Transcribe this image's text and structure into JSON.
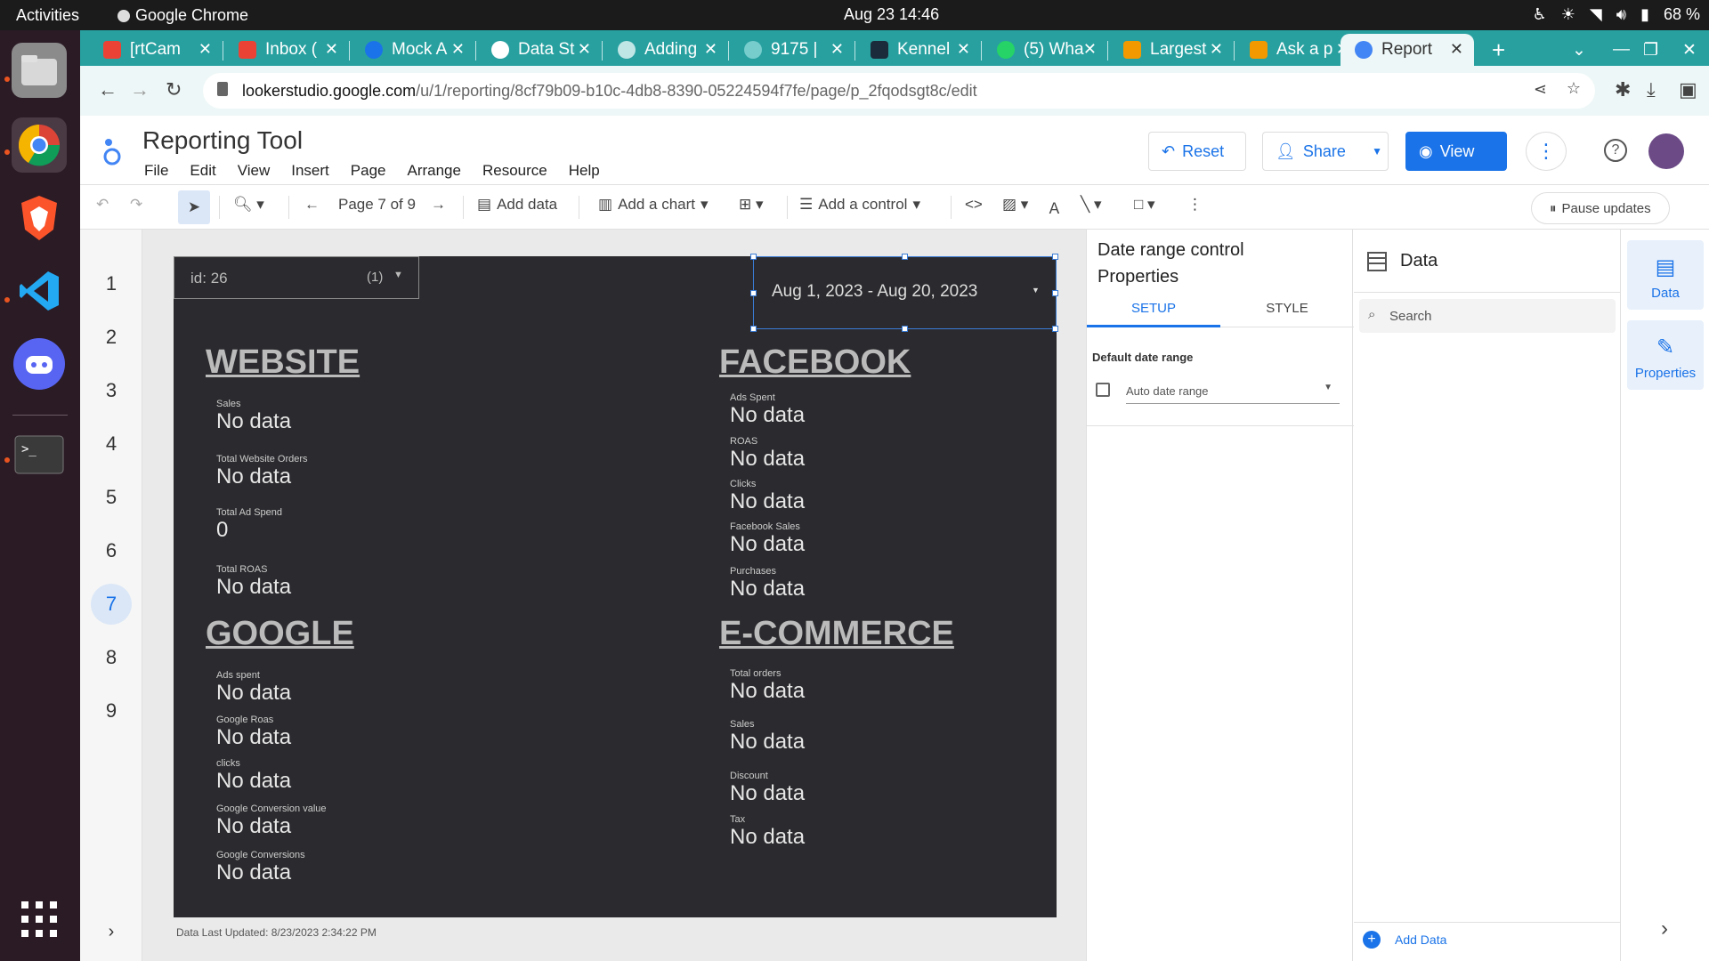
{
  "system": {
    "activities": "Activities",
    "app": "Google Chrome",
    "clock": "Aug 23  14:46",
    "battery": "68 %"
  },
  "tabs": [
    {
      "label": "[rtCam",
      "color": "#ea4335"
    },
    {
      "label": "Inbox (",
      "color": "#ea4335"
    },
    {
      "label": "Mock A",
      "color": "#1a73e8"
    },
    {
      "label": "Data St",
      "color": "#ffffff"
    },
    {
      "label": "Adding",
      "color": "#ffffff"
    },
    {
      "label": "9175 |",
      "color": "#999999"
    },
    {
      "label": "Kennel",
      "color": "#333333"
    },
    {
      "label": "(5) Wha",
      "color": "#25d366"
    },
    {
      "label": "Largest",
      "color": "#f29900"
    },
    {
      "label": "Ask a p",
      "color": "#f29900"
    },
    {
      "label": "Report",
      "color": "#4285f4"
    }
  ],
  "url": {
    "host": "lookerstudio.google.com",
    "path": "/u/1/reporting/8cf79b09-b10c-4db8-8390-05224594f7fe/page/p_2fqodsgt8c/edit"
  },
  "app": {
    "title": "Reporting Tool",
    "menu": [
      "File",
      "Edit",
      "View",
      "Insert",
      "Page",
      "Arrange",
      "Resource",
      "Help"
    ],
    "reset": "Reset",
    "share": "Share",
    "view": "View"
  },
  "toolbar": {
    "page": "Page 7 of 9",
    "add_data": "Add data",
    "add_chart": "Add a chart",
    "add_control": "Add a control",
    "pause": "Pause updates"
  },
  "pages": [
    "1",
    "2",
    "3",
    "4",
    "5",
    "6",
    "7",
    "8",
    "9"
  ],
  "canvas": {
    "id_control": {
      "label": "id",
      "value": "26",
      "count": "(1)"
    },
    "date_range": "Aug 1, 2023 - Aug 20, 2023",
    "website": {
      "title": "WEBSITE",
      "metrics": [
        {
          "label": "Sales",
          "value": "No data"
        },
        {
          "label": "Total Website Orders",
          "value": "No data"
        },
        {
          "label": "Total Ad Spend",
          "value": "0"
        },
        {
          "label": "Total ROAS",
          "value": "No data"
        }
      ]
    },
    "facebook": {
      "title": "FACEBOOK",
      "metrics": [
        {
          "label": "Ads Spent",
          "value": "No data"
        },
        {
          "label": "ROAS",
          "value": "No data"
        },
        {
          "label": "Clicks",
          "value": "No data"
        },
        {
          "label": "Facebook Sales",
          "value": "No data"
        },
        {
          "label": "Purchases",
          "value": "No data"
        }
      ]
    },
    "google": {
      "title": "GOOGLE",
      "metrics": [
        {
          "label": "Ads spent",
          "value": "No data"
        },
        {
          "label": "Google Roas",
          "value": "No data"
        },
        {
          "label": "clicks",
          "value": "No data"
        },
        {
          "label": "Google Conversion value",
          "value": "No data"
        },
        {
          "label": "Google Conversions",
          "value": "No data"
        }
      ]
    },
    "ecommerce": {
      "title": "E-COMMERCE ",
      "metrics": [
        {
          "label": "Total orders",
          "value": "No data"
        },
        {
          "label": "Sales",
          "value": "No data"
        },
        {
          "label": "Discount",
          "value": "No data"
        },
        {
          "label": "Tax",
          "value": "No data"
        }
      ]
    },
    "last_updated": "Data Last Updated: 8/23/2023 2:34:22 PM"
  },
  "properties": {
    "title_line1": "Date range control",
    "title_line2": "Properties",
    "tab_setup": "SETUP",
    "tab_style": "STYLE",
    "default_label": "Default date range",
    "default_value": "Auto date range"
  },
  "data_panel": {
    "title": "Data",
    "search_placeholder": "Search",
    "add_data": "Add Data"
  },
  "side_rail": {
    "data": "Data",
    "properties": "Properties"
  },
  "colors": {
    "tabbar": "#28a0a0",
    "accent": "#1a73e8",
    "canvas": "#2b2b2f"
  }
}
